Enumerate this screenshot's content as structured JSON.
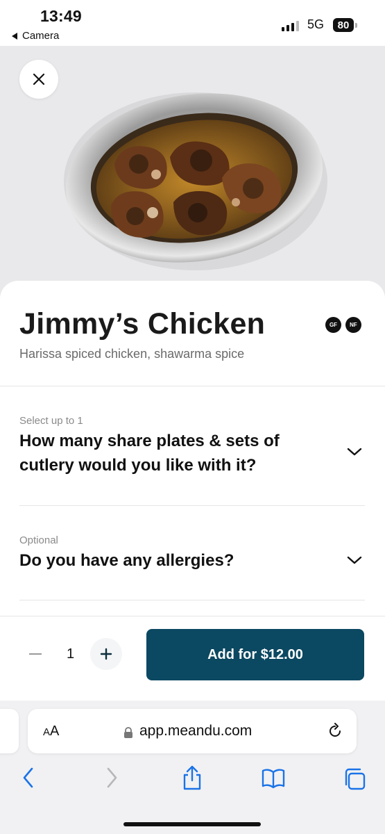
{
  "status_bar": {
    "time": "13:49",
    "back_app": "Camera",
    "network": "5G",
    "battery": "80"
  },
  "item": {
    "title": "Jimmy’s Chicken",
    "subtitle": "Harissa spiced chicken, shawarma spice",
    "badges": [
      "GF",
      "NF"
    ]
  },
  "options": [
    {
      "hint": "Select up to 1",
      "question_line1": "How many share plates & sets of",
      "question_line2": "cutlery would you like with it?"
    },
    {
      "hint": "Optional",
      "question": "Do you have any allergies?"
    }
  ],
  "order": {
    "quantity": "1",
    "add_label": "Add for $12.00"
  },
  "browser": {
    "aa_label_small": "A",
    "aa_label_big": "A",
    "url": "app.meandu.com"
  },
  "colors": {
    "accent": "#0b4861",
    "badge": "#111111"
  }
}
